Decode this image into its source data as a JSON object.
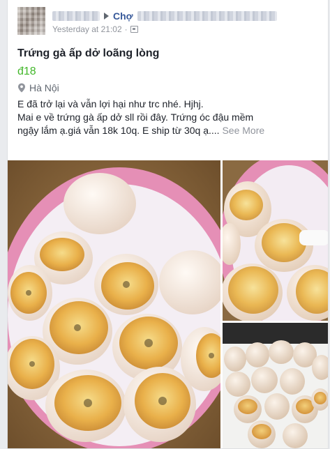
{
  "post": {
    "group": "Chợ",
    "timestamp": "Yesterday at 21:02",
    "separator": "·"
  },
  "listing": {
    "title": "Trứng gà ấp dở loãng lòng",
    "price": "đ18",
    "location": "Hà Nội",
    "description_lines": [
      "E đã trở lại và vẫn lợi hại như trc nhé. Hjhj.",
      "Mai e về trứng gà ấp dở sll rồi đây. Trứng óc đậu mềm",
      "ngậy lắm ạ.giá vẫn 18k 10q. E ship từ 30q ạ...."
    ],
    "see_more": "See More"
  },
  "icons": {
    "arrow": "triangle-right-icon",
    "audience": "audience-icon",
    "location": "pin-icon"
  },
  "colors": {
    "link": "#365899",
    "price": "#42b72a",
    "muted": "#90949c",
    "bowl_rim": "#e58fb6",
    "yolk": "#e9b04a"
  }
}
